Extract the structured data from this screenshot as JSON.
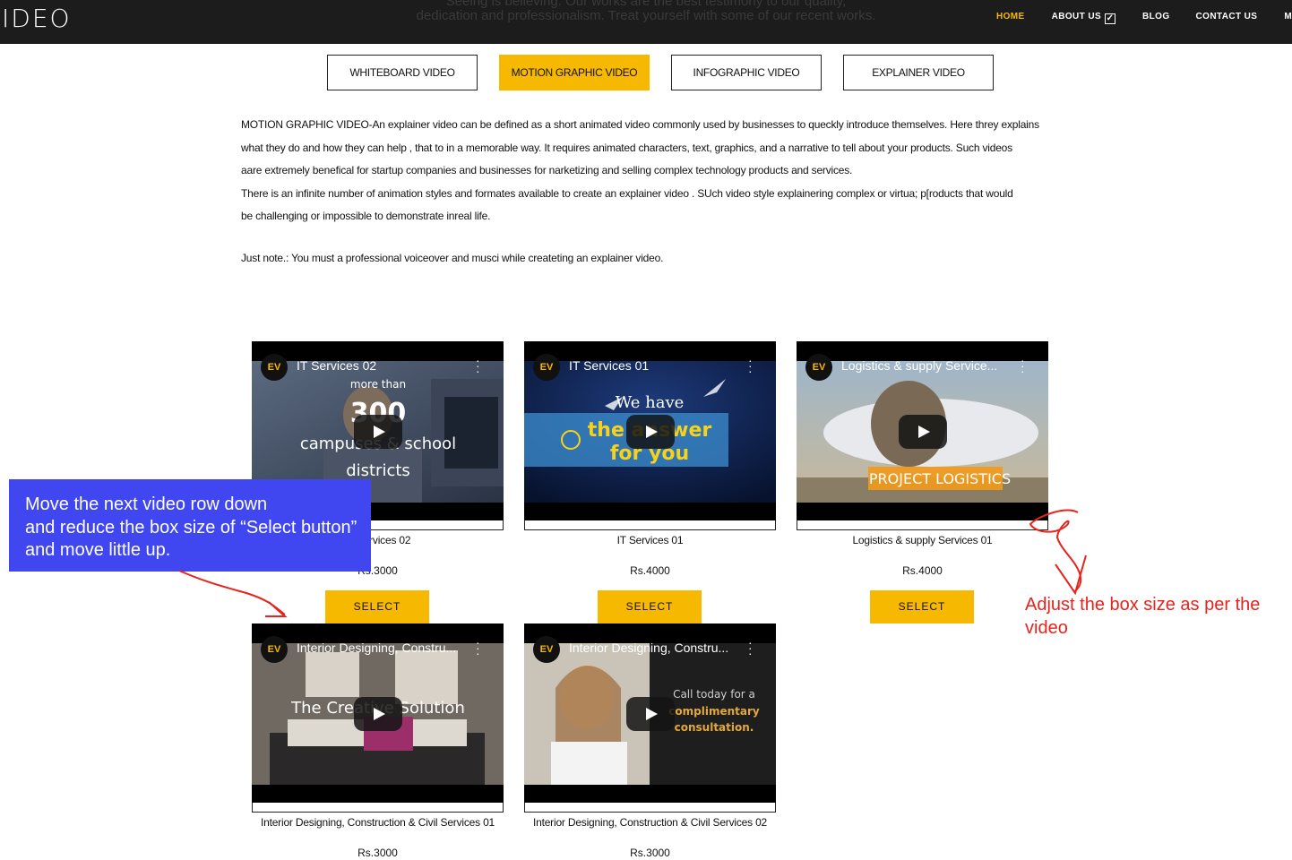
{
  "header": {
    "logo": "IDEO",
    "tagline_1": "Seeing is believing. Our works are the best testimony to our quality,",
    "tagline_2": "dedication and professionalism. Treat yourself with some of our recent works.",
    "nav": [
      {
        "label": "HOME",
        "active": true
      },
      {
        "label": "ABOUT US",
        "active": false
      },
      {
        "label": "BLOG",
        "active": false
      },
      {
        "label": "CONTACT US",
        "active": false
      },
      {
        "label": "MYC",
        "active": false
      }
    ]
  },
  "tabs": [
    {
      "label": "WHITEBOARD VIDEO",
      "active": false
    },
    {
      "label": "MOTION GRAPHIC VIDEO",
      "active": true
    },
    {
      "label": "INFOGRAPHIC VIDEO",
      "active": false
    },
    {
      "label": "EXPLAINER VIDEO",
      "active": false
    }
  ],
  "description": {
    "line1": "MOTION GRAPHIC VIDEO-An explainer video can be defined as a short animated video commonly used by businesses to queckly introduce themselves. Here threy explains",
    "line2": "what they do and how they can help , that to in a memorable way. It requires animated characters, text, graphics, and a narrative to tell about your products. Such videos",
    "line3": "aare extremely benefical for startup companies and businesses for narketizing and selling complex technology products and services.",
    "line4": "There is an infinite number of animation styles and formates available to create an explainer video . SUch video style explainering complex or virtua; p[roducts that would",
    "line5": "be challenging or impossible to demonstrate inreal life.",
    "note": "Just note.: You must a professional voiceover and musci while createting an explainer video."
  },
  "videos": [
    {
      "video_title": "IT Services 02",
      "overlay": [
        "more than",
        "300",
        "campuses & school",
        "districts"
      ],
      "caption": "IT Services 02",
      "price": "Rs.3000",
      "select_label": "SELECT"
    },
    {
      "video_title": "IT Services 01",
      "overlay": [
        "We have",
        "the answer",
        "for you"
      ],
      "caption": "IT Services 01",
      "price": "Rs.4000",
      "select_label": "SELECT"
    },
    {
      "video_title": "Logistics & supply Service...",
      "overlay": [
        "PROJECT LOGISTICS"
      ],
      "caption": "Logistics & supply Services 01",
      "price": "Rs.4000",
      "select_label": "SELECT"
    },
    {
      "video_title": "Interior Designing, Constru...",
      "overlay": [
        "The Creative Solution"
      ],
      "caption": "Interior Designing, Construction & Civil Services 01",
      "price": "Rs.3000"
    },
    {
      "video_title": "Interior Designing, Constru...",
      "overlay": [
        "Call today for a",
        "complimentary",
        "consultation."
      ],
      "caption": "Interior Designing, Construction & Civil Services 02",
      "price": "Rs.3000"
    }
  ],
  "channel_badge": "EV",
  "annotations": {
    "blue_note": [
      "Move the next video row down",
      "and reduce the box size of “Select button”",
      "and move little up."
    ],
    "red_note": [
      "Adjust the box size as per the",
      "video"
    ]
  },
  "colors": {
    "accent": "#f7b900",
    "header_bg": "#1c1c1c",
    "annotation_blue": "#4046f0",
    "annotation_red": "#e8231c"
  }
}
